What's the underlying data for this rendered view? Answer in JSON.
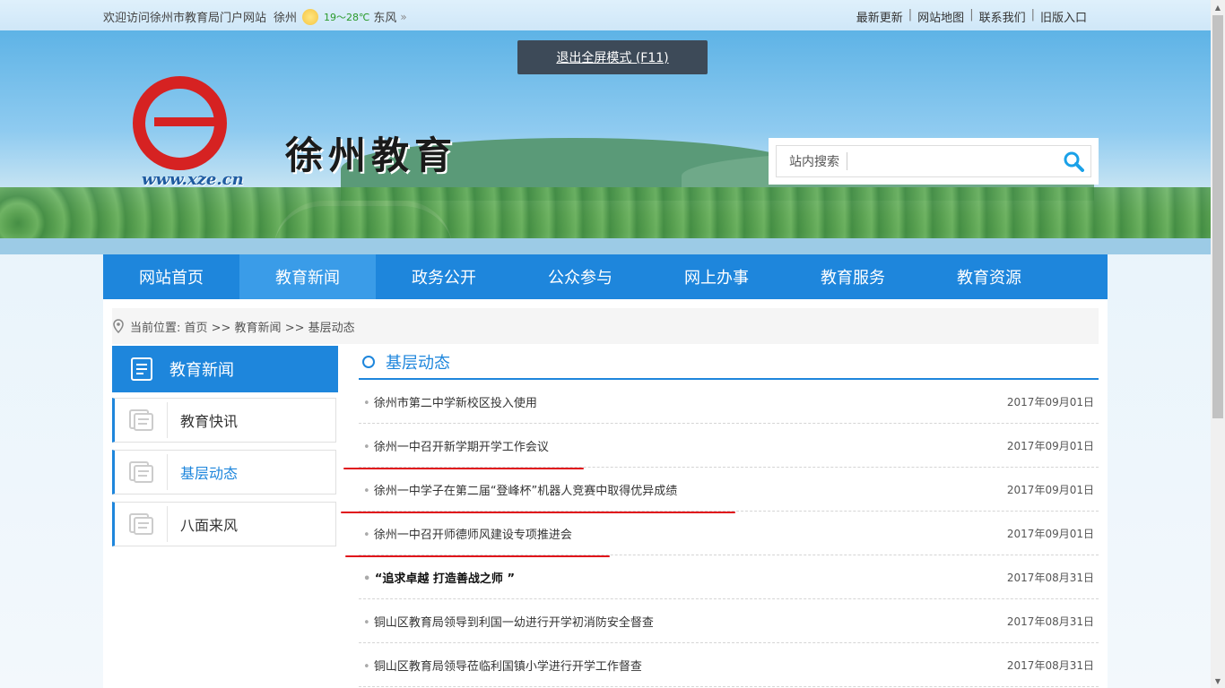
{
  "topbar": {
    "welcome": "欢迎访问徐州市教育局门户网站",
    "city": "徐州",
    "temperature": "19～28℃",
    "wind": "东风",
    "links": [
      "最新更新",
      "网站地图",
      "联系我们",
      "旧版入口"
    ]
  },
  "fullscreen": {
    "label": "退出全屏模式 (F11)"
  },
  "logo": {
    "title": "徐州教育",
    "url": "www.xze.cn"
  },
  "search": {
    "label": "站内搜索",
    "value": ""
  },
  "nav": {
    "items": [
      "网站首页",
      "教育新闻",
      "政务公开",
      "公众参与",
      "网上办事",
      "教育服务",
      "教育资源"
    ],
    "active_index": 1
  },
  "breadcrumb": {
    "text": "当前位置: 首页 >> 教育新闻 >> 基层动态"
  },
  "sidebar": {
    "header": "教育新闻",
    "items": [
      "教育快讯",
      "基层动态",
      "八面来风"
    ],
    "active_index": 1
  },
  "section": {
    "title": "基层动态"
  },
  "news": [
    {
      "title": "徐州市第二中学新校区投入使用",
      "date": "2017年09月01日"
    },
    {
      "title": "徐州一中召开新学期开学工作会议",
      "date": "2017年09月01日"
    },
    {
      "title": "徐州一中学子在第二届“登峰杯”机器人竞赛中取得优异成绩",
      "date": "2017年09月01日"
    },
    {
      "title": "徐州一中召开师德师风建设专项推进会",
      "date": "2017年09月01日"
    },
    {
      "title": "“追求卓越 打造善战之师 ”",
      "date": "2017年08月31日"
    },
    {
      "title": "铜山区教育局领导到利国一幼进行开学初消防安全督查",
      "date": "2017年08月31日"
    },
    {
      "title": "铜山区教育局领导莅临利国镇小学进行开学工作督查",
      "date": "2017年08月31日"
    }
  ],
  "colors": {
    "accent": "#1e86dc",
    "annotation": "#e0101a"
  }
}
